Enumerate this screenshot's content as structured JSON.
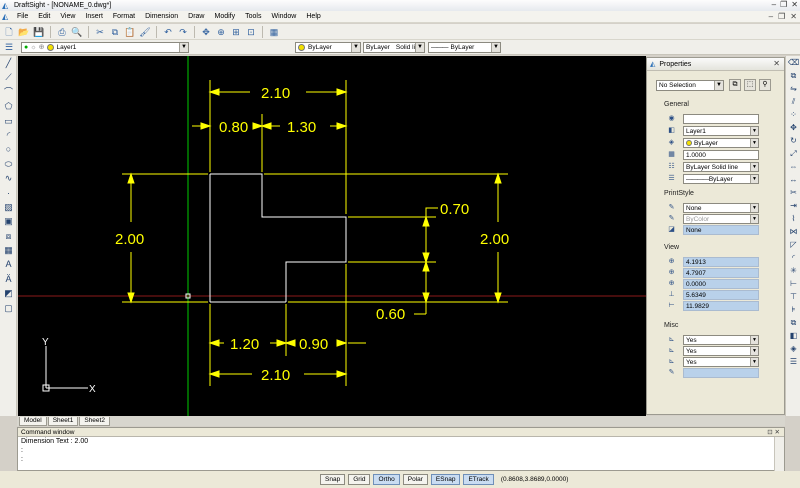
{
  "window": {
    "app_name": "DraftSight",
    "title": "DraftSight - [NONAME_0.dwg*]"
  },
  "menu": [
    "File",
    "Edit",
    "View",
    "Insert",
    "Format",
    "Dimension",
    "Draw",
    "Modify",
    "Tools",
    "Window",
    "Help"
  ],
  "toolbar": {
    "layer": "Layer1",
    "color": "ByLayer",
    "linetype": "ByLayer",
    "linestyle": "Solid line",
    "lineweight": "ByLayer"
  },
  "drawing": {
    "dimensions": {
      "top_overall": "2.10",
      "top_left": "0.80",
      "top_right": "1.30",
      "left_height": "2.00",
      "right_height": "2.00",
      "step_upper": "0.70",
      "step_lower": "0.60",
      "bottom_left": "1.20",
      "bottom_right": "0.90",
      "bottom_overall": "2.10"
    },
    "ucs": {
      "x_label": "X",
      "y_label": "Y"
    },
    "colors": {
      "geometry": "#ffffff",
      "dimension": "#ffff00",
      "y_axis": "#00cc00",
      "x_axis": "#8b1a1a"
    }
  },
  "properties": {
    "title": "Properties",
    "selection": "No Selection",
    "general": {
      "heading": "General",
      "color_value": "",
      "layer": "Layer1",
      "color": "ByLayer",
      "linetype_scale": "1.0000",
      "linetype": "ByLayer",
      "linetype_style": "Solid line",
      "lineweight": "ByLayer"
    },
    "printstyle": {
      "heading": "PrintStyle",
      "style": "None",
      "table": "ByColor",
      "table_type": "None"
    },
    "view": {
      "heading": "View",
      "values": [
        "4.1913",
        "4.7907",
        "0.0000",
        "5.6349",
        "11.9829"
      ]
    },
    "misc": {
      "heading": "Misc",
      "values": [
        "Yes",
        "Yes",
        "Yes",
        ""
      ]
    }
  },
  "tabs": [
    "Model",
    "Sheet1",
    "Sheet2"
  ],
  "command_window": {
    "title": "Command window",
    "lines": [
      "Dimension Text : 2.00",
      ":",
      ":"
    ]
  },
  "status": {
    "buttons": [
      {
        "label": "Snap",
        "on": false
      },
      {
        "label": "Grid",
        "on": false
      },
      {
        "label": "Ortho",
        "on": true
      },
      {
        "label": "Polar",
        "on": false
      },
      {
        "label": "ESnap",
        "on": true
      },
      {
        "label": "ETrack",
        "on": true
      }
    ],
    "coords": "(0.8608,3.8689,0.0000)"
  }
}
